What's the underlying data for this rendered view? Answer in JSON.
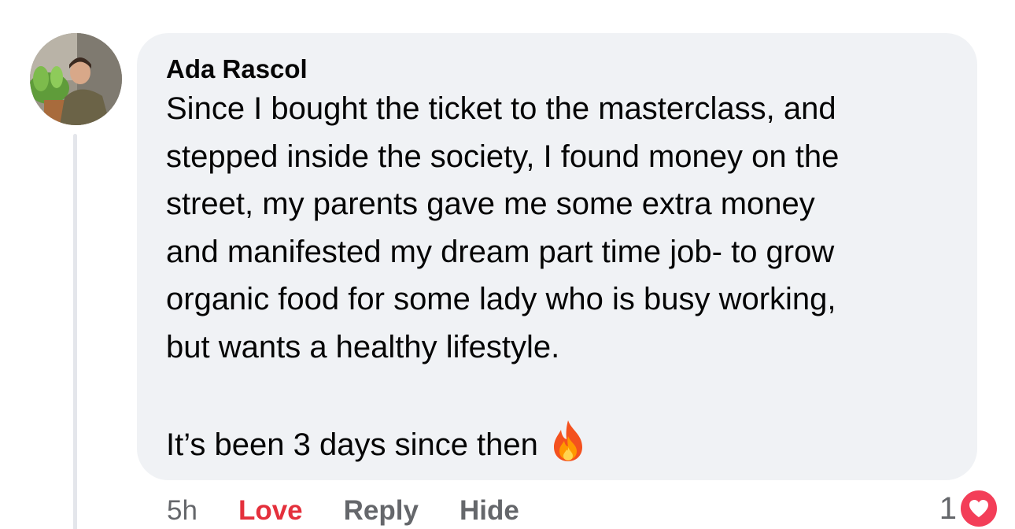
{
  "comment": {
    "author": "Ada Rascol",
    "body_lines": [
      "Since I bought the ticket to the masterclass, and",
      "stepped inside the society, I found money on the",
      "street, my parents gave me some extra money",
      "and manifested my dream part time job- to grow",
      "organic food for some lady who is busy working,",
      "but wants a healthy lifestyle."
    ],
    "final_line": "It’s been 3 days since then",
    "emoji": "fire-icon"
  },
  "actions": {
    "time": "5h",
    "love_label": "Love",
    "reply_label": "Reply",
    "hide_label": "Hide"
  },
  "reactions": {
    "count": "1",
    "icon": "heart-icon"
  },
  "colors": {
    "bubble": "#f0f2f5",
    "love": "#e4303c",
    "muted": "#65676b",
    "heart": "#f33e58"
  }
}
